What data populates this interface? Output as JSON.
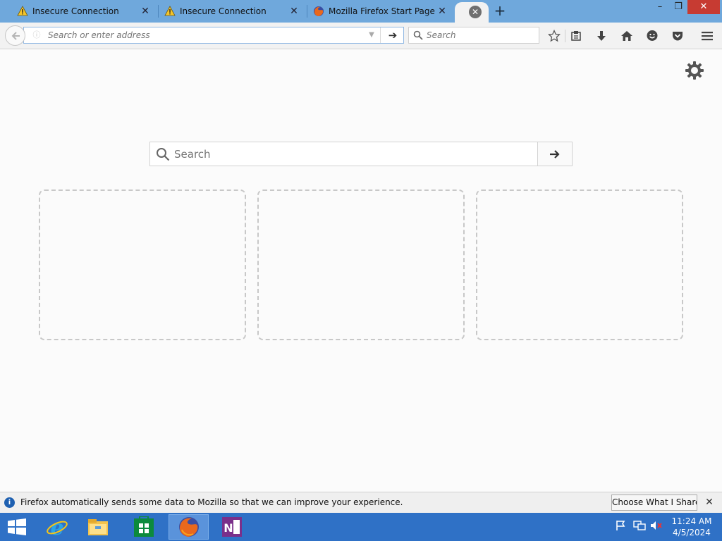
{
  "tabs": [
    {
      "label": "Insecure Connection",
      "icon": "warning-icon"
    },
    {
      "label": "Insecure Connection",
      "icon": "warning-icon"
    },
    {
      "label": "Mozilla Firefox Start Page",
      "icon": "firefox-icon"
    }
  ],
  "navbar": {
    "url_placeholder": "Search or enter address",
    "search_placeholder": "Search"
  },
  "content": {
    "search_placeholder": "Search"
  },
  "notification": {
    "text": "Firefox automatically sends some data to Mozilla so that we can improve your experience.",
    "button_label": "Choose What I Share"
  },
  "taskbar": {
    "apps": [
      "internet-explorer-icon",
      "file-explorer-icon",
      "store-icon",
      "firefox-icon",
      "onenote-icon"
    ],
    "time": "11:24 AM",
    "date": "4/5/2024"
  },
  "colors": {
    "tabstrip": "#6fa8dc",
    "taskbar": "#2f71c6",
    "close_red": "#c73b32"
  }
}
